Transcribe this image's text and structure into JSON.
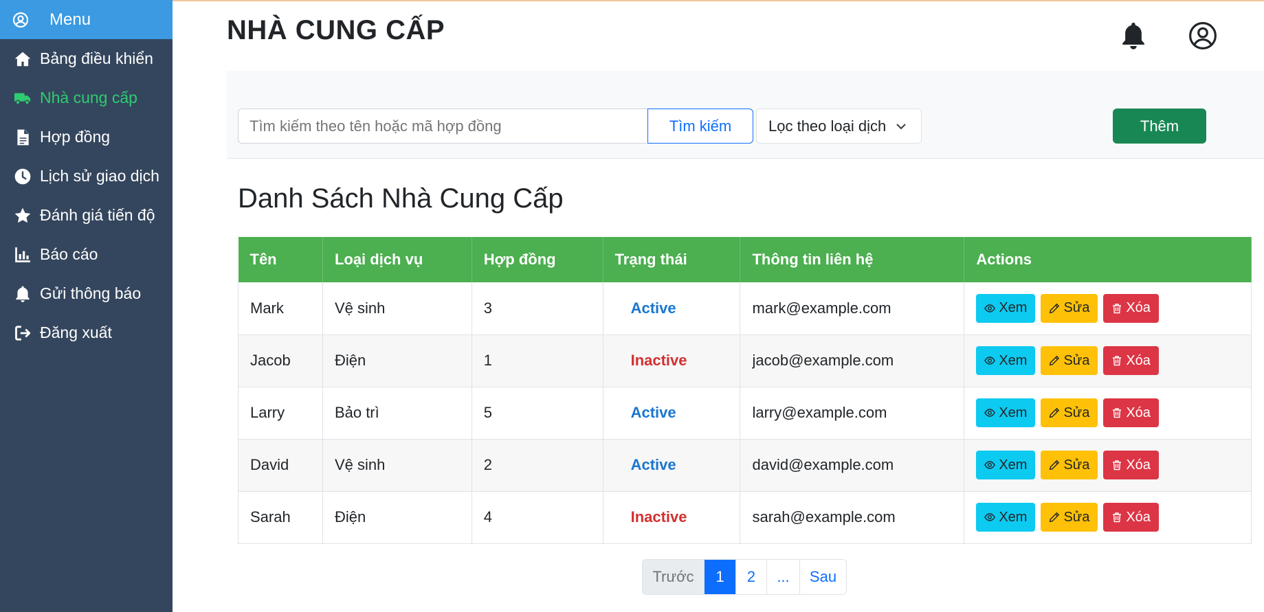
{
  "sidebar": {
    "menu_label": "Menu",
    "items": [
      {
        "label": "Bảng điều khiển",
        "icon": "home-icon"
      },
      {
        "label": "Nhà cung cấp",
        "icon": "truck-icon"
      },
      {
        "label": "Hợp đồng",
        "icon": "file-icon"
      },
      {
        "label": "Lịch sử giao dịch",
        "icon": "clock-icon"
      },
      {
        "label": "Đánh giá tiến độ",
        "icon": "star-icon"
      },
      {
        "label": "Báo cáo",
        "icon": "bar-chart-icon"
      },
      {
        "label": "Gửi thông báo",
        "icon": "bell-icon"
      },
      {
        "label": "Đăng xuất",
        "icon": "logout-icon"
      }
    ]
  },
  "header": {
    "title": "NHÀ CUNG CẤP"
  },
  "toolbar": {
    "search_placeholder": "Tìm kiếm theo tên hoặc mã hợp đồng",
    "search_label": "Tìm kiếm",
    "filter_label": "Lọc theo loại dịch",
    "add_label": "Thêm"
  },
  "section": {
    "title": "Danh Sách Nhà Cung Cấp"
  },
  "table": {
    "headers": [
      "Tên",
      "Loại dịch vụ",
      "Hợp đồng",
      "Trạng thái",
      "Thông tin liên hệ",
      "Actions"
    ],
    "rows": [
      {
        "name": "Mark",
        "service": "Vệ sinh",
        "contracts": "3",
        "status": "Active",
        "contact": "mark@example.com"
      },
      {
        "name": "Jacob",
        "service": "Điện",
        "contracts": "1",
        "status": "Inactive",
        "contact": "jacob@example.com"
      },
      {
        "name": "Larry",
        "service": "Bảo trì",
        "contracts": "5",
        "status": "Active",
        "contact": "larry@example.com"
      },
      {
        "name": "David",
        "service": "Vệ sinh",
        "contracts": "2",
        "status": "Active",
        "contact": "david@example.com"
      },
      {
        "name": "Sarah",
        "service": "Điện",
        "contracts": "4",
        "status": "Inactive",
        "contact": "sarah@example.com"
      }
    ],
    "actions": {
      "view": "Xem",
      "edit": "Sửa",
      "delete": "Xóa"
    }
  },
  "pagination": {
    "prev": "Trước",
    "pages": [
      "1",
      "2",
      "..."
    ],
    "next": "Sau",
    "current": "1"
  },
  "colors": {
    "sidebar_bg": "#34465d",
    "menu_head_bg": "#3b9ae1",
    "active_nav": "#2ecc71",
    "table_header": "#4caf50",
    "add_button": "#198754"
  }
}
